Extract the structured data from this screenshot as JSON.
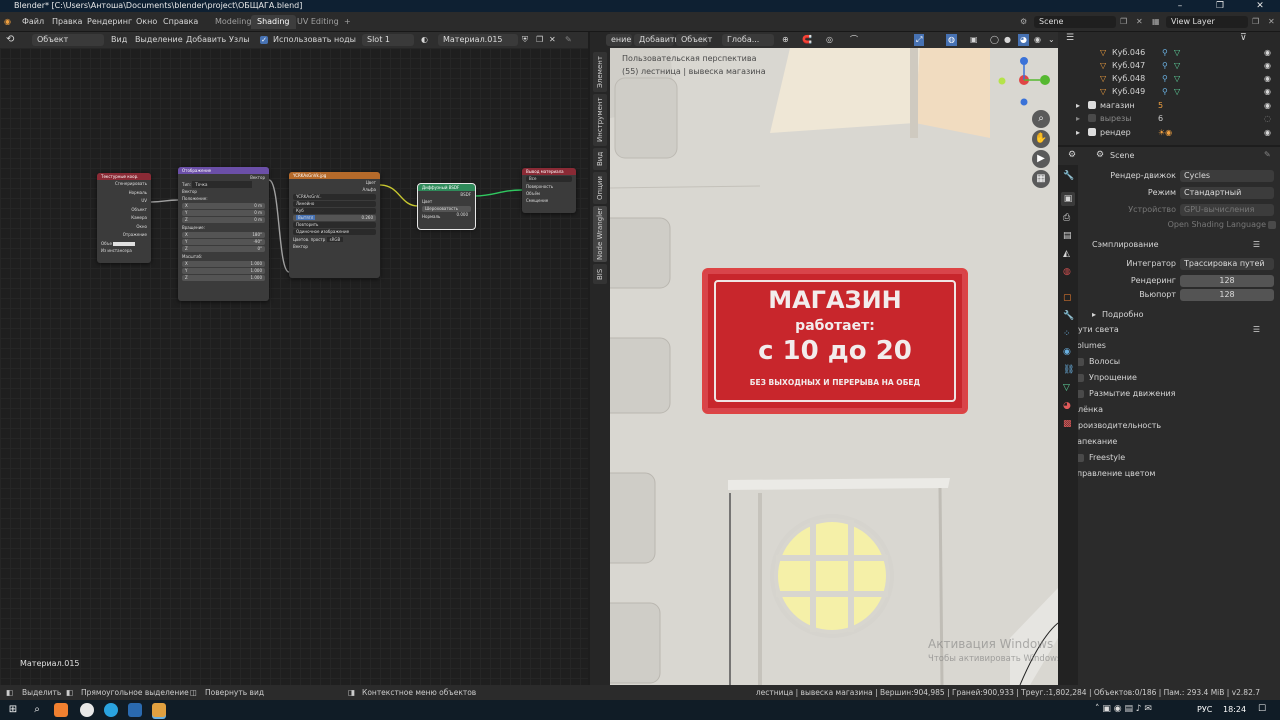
{
  "window": {
    "title": "Blender* [C:\\Users\\Антоша\\Documents\\blender\\project\\ОБЩАГА.blend]",
    "minimize": "–",
    "maximize": "❐",
    "close": "✕"
  },
  "menu": {
    "items": [
      "Файл",
      "Правка",
      "Рендеринг",
      "Окно",
      "Справка"
    ]
  },
  "workspaces": {
    "tabs": [
      "Modeling",
      "Shading",
      "UV Editing"
    ],
    "active": "Shading",
    "add": "+"
  },
  "scene": {
    "label": "Scene",
    "view_layer": "View Layer"
  },
  "node_header": {
    "mode": "Объект",
    "menus": [
      "Вид",
      "Выделение",
      "Добавить",
      "Узлы"
    ],
    "use_nodes_label": "Использовать ноды",
    "slot": "Slot 1",
    "material": "Материал.015"
  },
  "nodes": {
    "texcoord": {
      "title": "Текстурные коор.",
      "outputs": [
        "Сгенерировать",
        "Нормаль",
        "UV",
        "Объект",
        "Камера",
        "Окно",
        "Отражение"
      ],
      "object_label": "Объе",
      "instancer": "Из инстансера"
    },
    "mapping": {
      "title": "Отображение",
      "out": "Вектор",
      "type_label": "Тип:",
      "type": "Точка",
      "vector": "Вектор",
      "location": "Положение:",
      "rotation": "Вращение:",
      "scale": "Масштаб:",
      "loc": [
        {
          "axis": "X",
          "val": "0 m"
        },
        {
          "axis": "Y",
          "val": "0 m"
        },
        {
          "axis": "Z",
          "val": "0 m"
        }
      ],
      "rot": [
        {
          "axis": "X",
          "val": "180°"
        },
        {
          "axis": "Y",
          "val": "-90°"
        },
        {
          "axis": "Z",
          "val": "0°"
        }
      ],
      "scl": [
        {
          "axis": "X",
          "val": "1.000"
        },
        {
          "axis": "Y",
          "val": "1.000"
        },
        {
          "axis": "Z",
          "val": "1.000"
        }
      ]
    },
    "image": {
      "title": "YCRKAsGnVk.jpg",
      "color": "Цвет",
      "alpha": "Альфа",
      "file": "YCRKAsGnV..",
      "interp": "Линейно",
      "proj": "Куб",
      "blend_label": "Вытягл",
      "blend": "0.260",
      "ext": "Повторить",
      "source": "Одиночное изображение",
      "cs_label": "Цветов. простр",
      "cs": "sRGB",
      "vector": "Вектор"
    },
    "bsdf": {
      "title": "Диффузный BSDF",
      "out": "BSDF",
      "color": "Цвет",
      "rough_label": "Шероховатость",
      "rough": "0.000",
      "normal": "Нормаль"
    },
    "output": {
      "title": "Вывод материала",
      "target": "Все",
      "inputs": [
        "Поверхность",
        "Объём",
        "Смещение"
      ]
    }
  },
  "node_editor": {
    "material_label": "Материал.015"
  },
  "side_tabs": [
    "Элемент",
    "Инструмент",
    "Вид",
    "Опции",
    "Node Wrangler",
    "BIS"
  ],
  "viewport_header": {
    "menus": [
      "ение",
      "Добавить",
      "Объект"
    ],
    "orientation": "Глоба..."
  },
  "viewport": {
    "overlay_line1": "Пользовательская перспектива",
    "overlay_line2": "(55) лестница | вывеска магазина",
    "sign": {
      "line1": "МАГАЗИН",
      "line2": "работает:",
      "line3": "с 10 до 20",
      "line4": "БЕЗ ВЫХОДНЫХ И ПЕРЕРЫВА НА ОБЕД"
    },
    "watermark1": "Активация Windows",
    "watermark2": "Чтобы активировать Windows, перейдите в раздел \"Параметры\"."
  },
  "outliner": {
    "rows": [
      {
        "name": "Куб.046"
      },
      {
        "name": "Куб.047"
      },
      {
        "name": "Куб.048"
      },
      {
        "name": "Куб.049"
      },
      {
        "name": "магазин",
        "badge": "5"
      },
      {
        "name": "вырезы",
        "badge": "6"
      },
      {
        "name": "рендер"
      }
    ]
  },
  "properties": {
    "scene": "Scene",
    "engine_label": "Рендер-движок",
    "engine": "Cycles",
    "mode_label": "Режим",
    "mode": "Стандартный",
    "device_label": "Устройство",
    "device": "GPU-вычисления",
    "osl": "Open Shading Language",
    "sampling": "Сэмплирование",
    "integrator_label": "Интегратор",
    "integrator": "Трассировка путей",
    "render_label": "Рендеринг",
    "render": "128",
    "viewport_label": "Вьюпорт",
    "viewport": "128",
    "details": "Подробно",
    "panels": [
      {
        "label": "Пути света",
        "cb": false
      },
      {
        "label": "Volumes",
        "cb": false
      },
      {
        "label": "Волосы",
        "cb": true
      },
      {
        "label": "Упрощение",
        "cb": true
      },
      {
        "label": "Размытие движения",
        "cb": true
      },
      {
        "label": "Плёнка",
        "cb": false
      },
      {
        "label": "Производительность",
        "cb": false
      },
      {
        "label": "Запекание",
        "cb": false
      },
      {
        "label": "Freestyle",
        "cb": true
      },
      {
        "label": "Управление цветом",
        "cb": false
      }
    ]
  },
  "status": {
    "select": "Выделить",
    "box": "Прямоугольное выделение",
    "rotate": "Повернуть вид",
    "context": "Контекстное меню объектов",
    "info": "лестница | вывеска магазина | Вершин:904,985 | Граней:900,933 | Треуг.:1,802,284 | Объектов:0/186 | Пам.: 293.4 MiB | v2.82.7"
  },
  "taskbar": {
    "lang": "РУС",
    "time": "18:24"
  },
  "colors": {
    "accent": "#4772b3",
    "sign_red": "#c8262c",
    "node_purple": "#6b4fa8",
    "node_orange": "#b56a2a",
    "node_green": "#2f8a5a",
    "node_red": "#8a2a35"
  }
}
